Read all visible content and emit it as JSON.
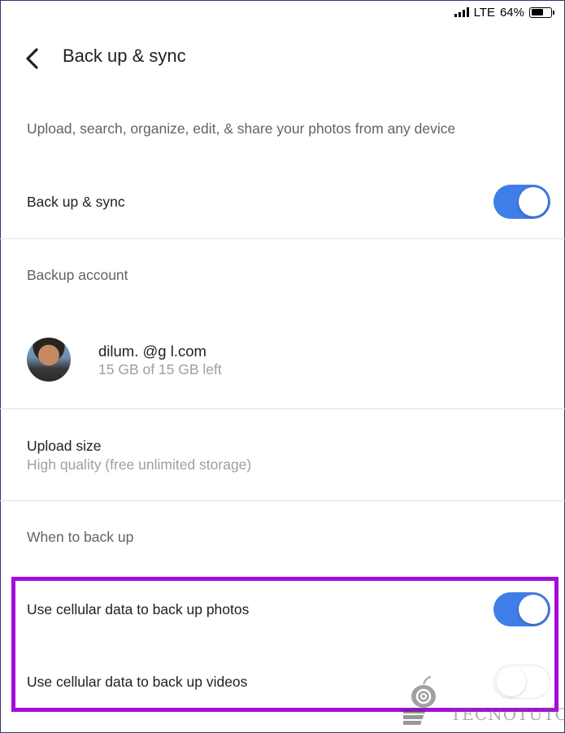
{
  "status_bar": {
    "network": "LTE",
    "battery_percent": "64%",
    "battery_level": 0.64
  },
  "header": {
    "title": "Back up & sync"
  },
  "description": "Upload, search, organize, edit, & share your photos from any device",
  "backup_sync": {
    "label": "Back up & sync",
    "enabled": true
  },
  "backup_account": {
    "section_label": "Backup account",
    "email": "dilum.         @g    l.com",
    "storage": "15 GB of 15 GB left"
  },
  "upload_size": {
    "label": "Upload size",
    "value": "High quality (free unlimited storage)"
  },
  "when_to_back_up": {
    "section_label": "When to back up",
    "cellular_photos": {
      "label": "Use cellular data to back up photos",
      "enabled": true
    },
    "cellular_videos": {
      "label": "Use cellular data to back up videos",
      "enabled": false
    }
  },
  "watermark": {
    "text": "TECNOTUTO"
  },
  "colors": {
    "accent": "#3f7ee8",
    "highlight": "#a50cdc"
  }
}
